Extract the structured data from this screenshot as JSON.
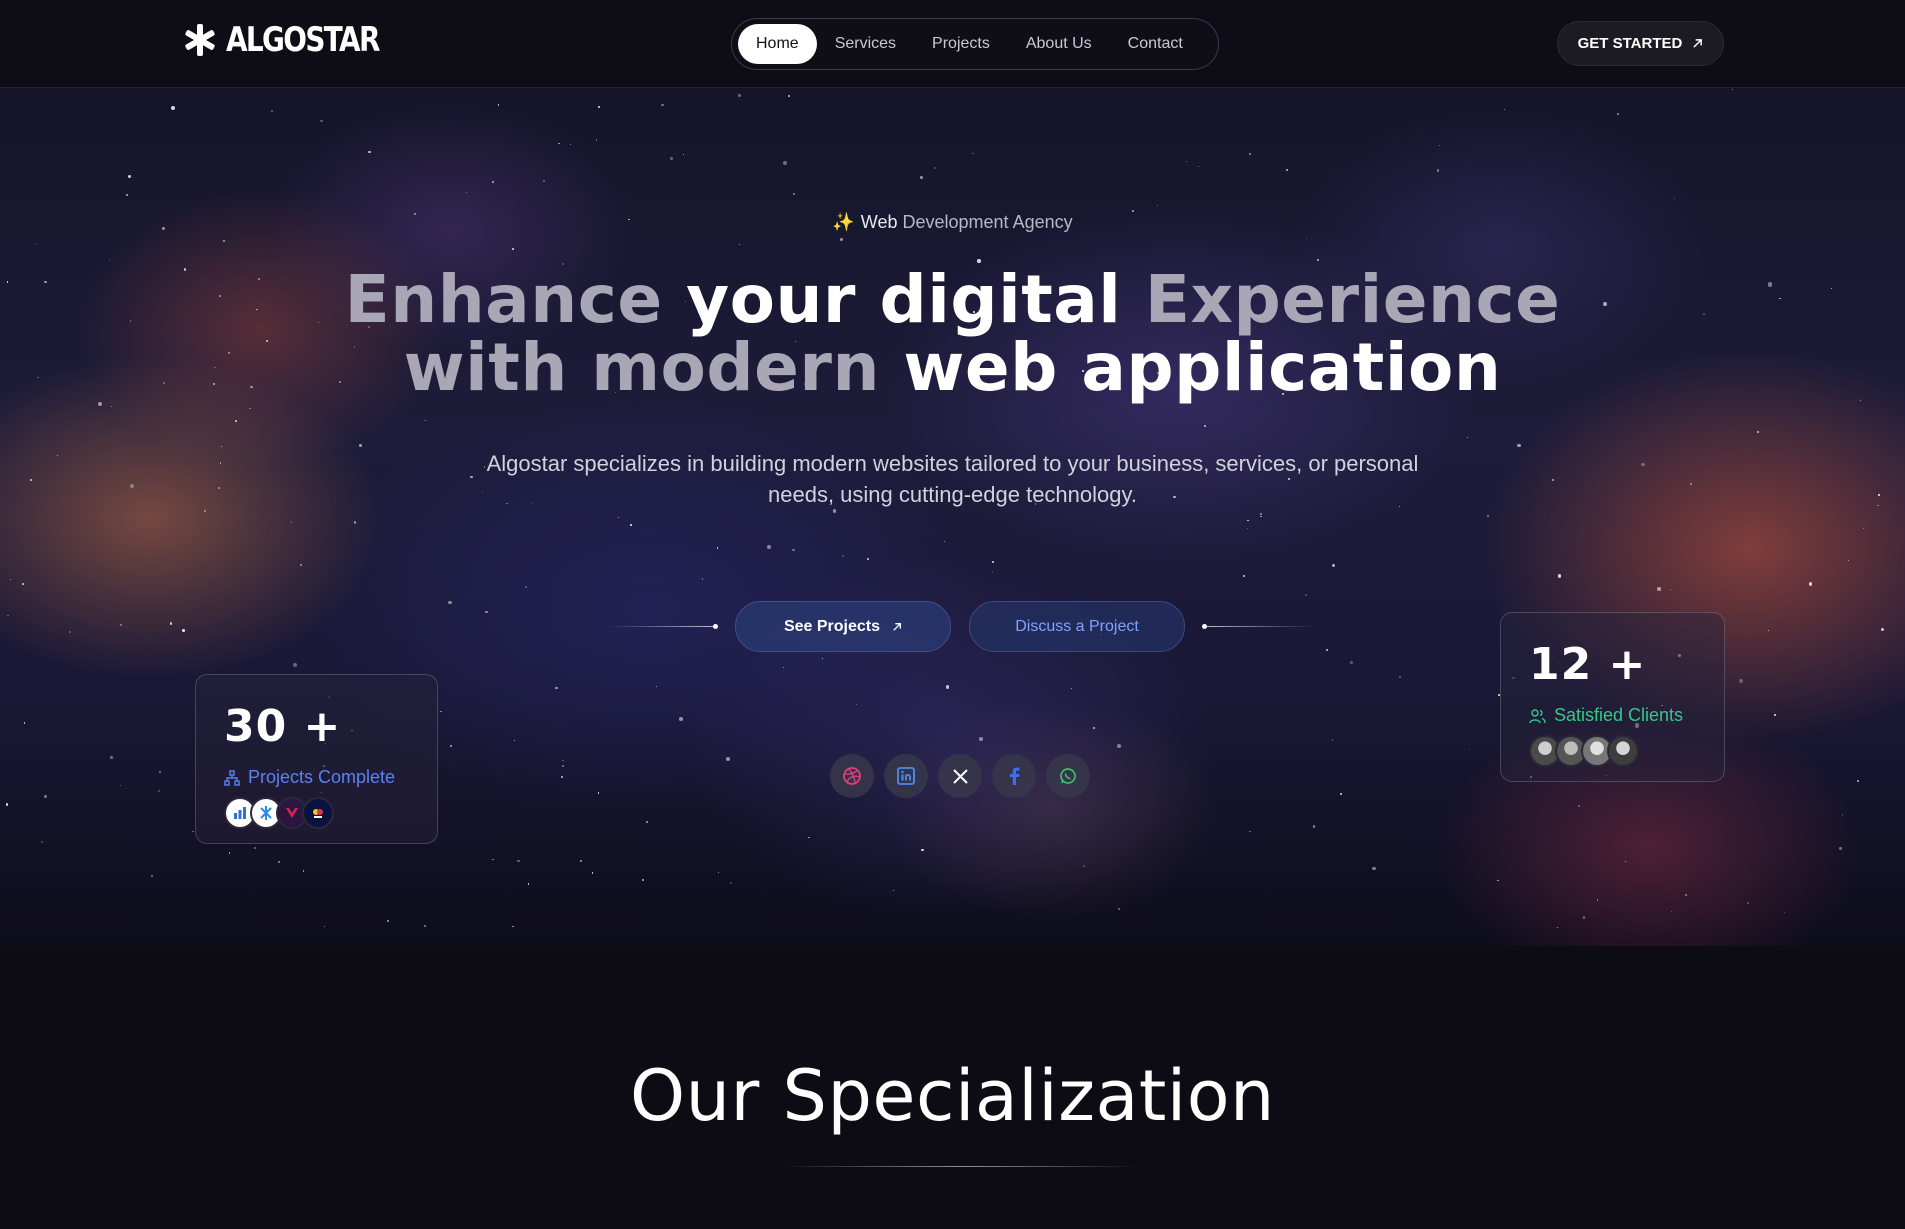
{
  "brand": {
    "name": "ALGOSTAR"
  },
  "nav": {
    "items": [
      {
        "label": "Home",
        "active": true
      },
      {
        "label": "Services"
      },
      {
        "label": "Projects"
      },
      {
        "label": "About Us"
      },
      {
        "label": "Contact"
      }
    ],
    "cta": "GET STARTED"
  },
  "hero": {
    "badge_strong": "Web",
    "badge_rest": "Development Agency",
    "headline": {
      "line1_dim": "Enhance ",
      "line1_bright": "your digital ",
      "line1_dim2": "Experience",
      "line2_dim": "with modern ",
      "line2_bright": "web application"
    },
    "subtitle": "Algostar specializes in building modern websites tailored to your business, services, or personal needs, using cutting-edge technology.",
    "buttons": {
      "primary": "See Projects",
      "secondary": "Discuss a Project"
    },
    "socials": [
      "dribbble-icon",
      "linkedin-icon",
      "x-icon",
      "facebook-icon",
      "whatsapp-icon"
    ]
  },
  "stats": {
    "projects": {
      "value": "30 +",
      "label": "Projects Complete"
    },
    "clients": {
      "value": "12 +",
      "label": "Satisfied Clients"
    }
  },
  "specialization": {
    "title": "Our Specialization"
  },
  "colors": {
    "accent_blue": "#5b82f0",
    "accent_green": "#34c98a",
    "background": "#0d0c14"
  }
}
